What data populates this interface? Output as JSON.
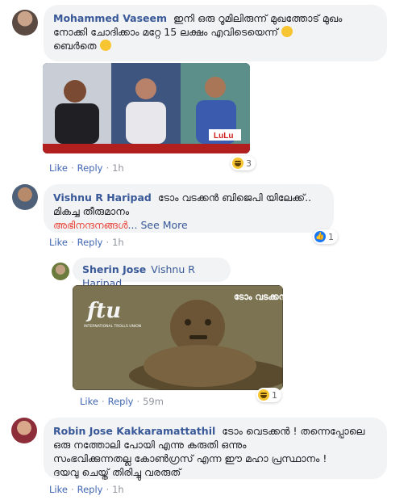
{
  "comments": [
    {
      "author": "Mohammed Vaseem",
      "text_line1": "ഇനി ഒരു റൂമിലിരുന്ന് മുഖത്തോട് മുഖം",
      "text_line2": "നോക്കി ചോദിക്കാം മറ്റേ 15 ലക്ഷം എവിടെയെന്ന്",
      "text_line3": "ബെർതെ",
      "actions": {
        "like": "Like",
        "reply": "Reply",
        "time": "1h"
      },
      "reaction_count": "3",
      "image_tag": "LuLu"
    },
    {
      "author": "Vishnu R Haripad",
      "text_line1": "ടോം വടക്കൻ ബിജെപി യിലേക്ക്..",
      "text_line2": "മികച്ച തീരുമാനം",
      "text_line3_red": "അഭിനന്ദനങ്ങൾ",
      "see_more": "... See More",
      "actions": {
        "like": "Like",
        "reply": "Reply",
        "time": "1h"
      },
      "reaction_count": "1"
    },
    {
      "author": "Sherin Jose",
      "mention": "Vishnu R Haripad",
      "image_caption": "ടോം വടക്കൻ",
      "image_logo": "ftu",
      "image_logo_sub": "INTERNATIONAL TROLLS UNION",
      "actions": {
        "like": "Like",
        "reply": "Reply",
        "time": "59m"
      },
      "reaction_count": "1"
    },
    {
      "author": "Robin Jose Kakkaramattathil",
      "text_line1": "ടോം വെടക്കൻ ! തന്നെപ്പോലെ",
      "text_line2": "ഒരു നത്തോലി പോയി എന്നു കരുതി ഒന്നും",
      "text_line3": "സംഭവിക്കുന്നതല്ല കോൺഗ്രസ് എന്ന ഈ മഹാ പ്രസ്ഥാനം !",
      "text_line4": "ദയവു ചെയ്ത് തിരിച്ചു വരരുത്",
      "actions": {
        "like": "Like",
        "reply": "Reply",
        "time": "1h"
      }
    }
  ],
  "colors": {
    "link": "#385898",
    "action": "#4267b2",
    "bubble": "#f2f3f5",
    "red": "#e7473c"
  },
  "icons": [
    "haha-reaction-icon",
    "like-reaction-icon",
    "grin-emoji-icon",
    "smile-emoji-icon"
  ]
}
